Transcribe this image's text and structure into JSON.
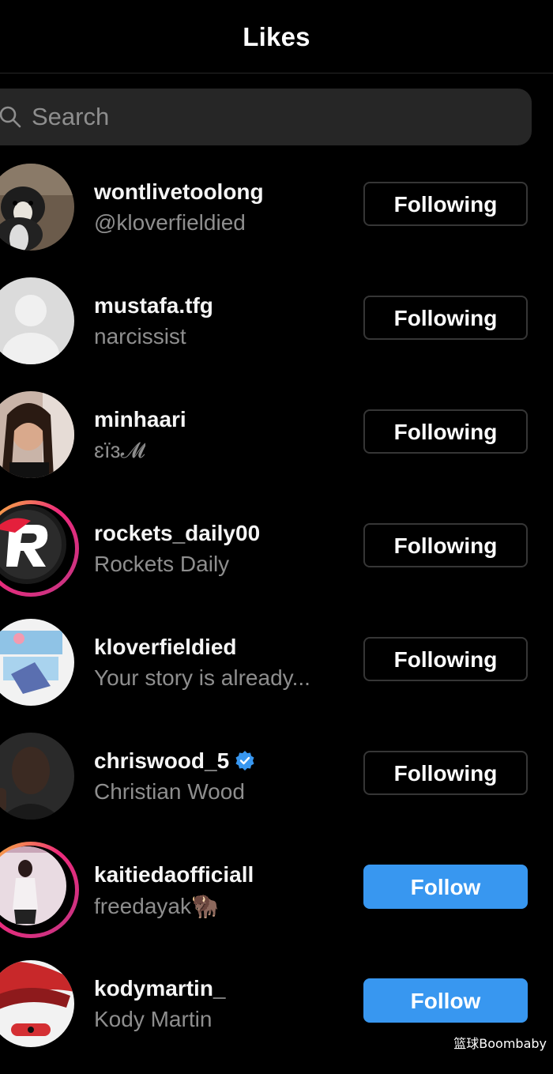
{
  "header": {
    "title": "Likes"
  },
  "search": {
    "placeholder": "Search",
    "value": ""
  },
  "users": [
    {
      "username": "wontlivetoolong",
      "subtitle": "@kloverfieldied",
      "button": "Following",
      "verified": false
    },
    {
      "username": "mustafa.tfg",
      "subtitle": "narcissist",
      "button": "Following",
      "verified": false
    },
    {
      "username": "minhaari",
      "subtitle": "ɛïɜ𝓜",
      "button": "Following",
      "verified": false
    },
    {
      "username": "rockets_daily00",
      "subtitle": "Rockets Daily",
      "button": "Following",
      "verified": false
    },
    {
      "username": "kloverfieldied",
      "subtitle": "Your story is already...",
      "button": "Following",
      "verified": false
    },
    {
      "username": "chriswood_5",
      "subtitle": "Christian Wood",
      "button": "Following",
      "verified": true
    },
    {
      "username": "kaitiedaofficiall",
      "subtitle": "freedayak🦬",
      "button": "Follow",
      "verified": false
    },
    {
      "username": "kodymartin_",
      "subtitle": "Kody Martin",
      "button": "Follow",
      "verified": false
    }
  ],
  "watermark": "篮球Boombaby",
  "colors": {
    "background": "#000000",
    "follow_button": "#3897f0",
    "following_border": "#363636",
    "subtitle": "#8e8e8e",
    "verified": "#3897f0"
  }
}
